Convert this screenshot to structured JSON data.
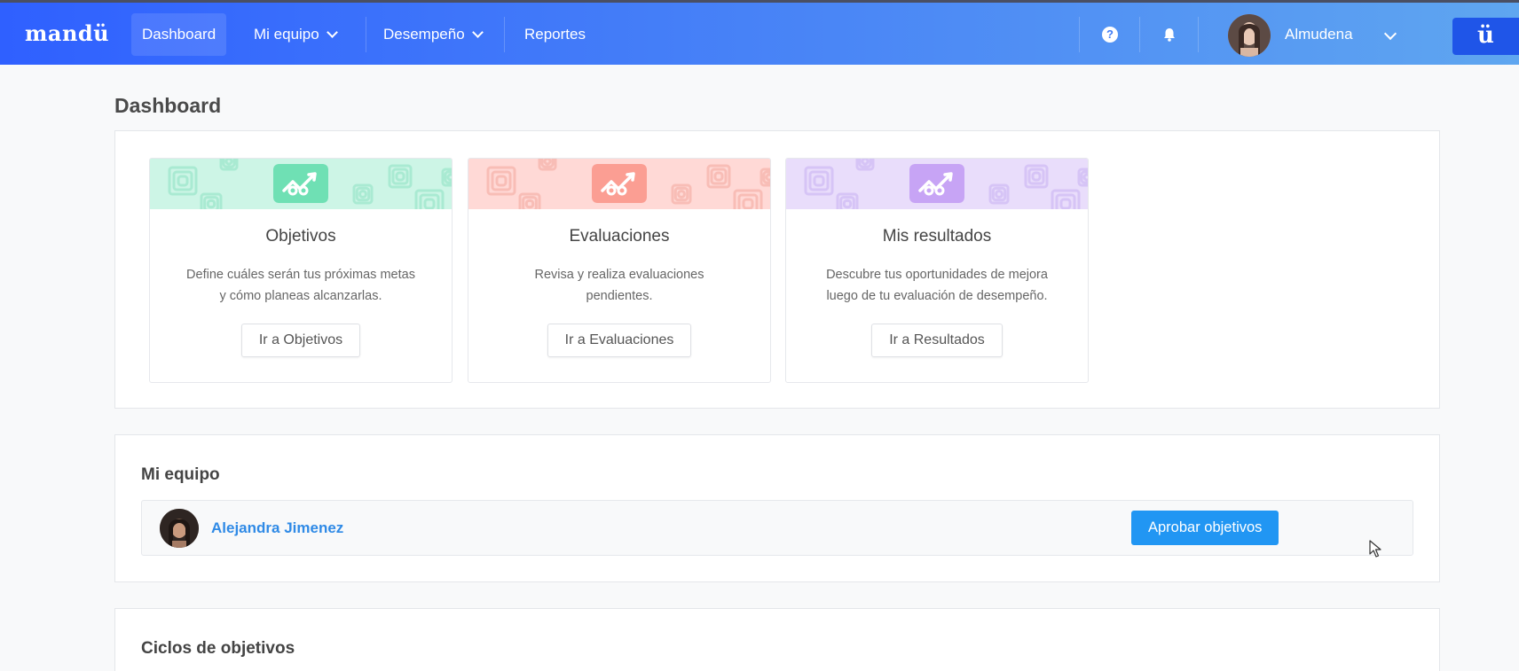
{
  "app": {
    "logo_text": "mandü",
    "brand_button_text": "ü"
  },
  "nav": {
    "items": [
      {
        "label": "Dashboard",
        "active": true,
        "has_dropdown": false
      },
      {
        "label": "Mi equipo",
        "active": false,
        "has_dropdown": true
      },
      {
        "label": "Desempeño",
        "active": false,
        "has_dropdown": true
      },
      {
        "label": "Reportes",
        "active": false,
        "has_dropdown": false
      }
    ],
    "help_icon": "question-circle-icon",
    "help_glyph": "?",
    "notifications_icon": "bell-icon",
    "user": {
      "name": "Almudena"
    }
  },
  "page": {
    "title": "Dashboard"
  },
  "cards": [
    {
      "title": "Objetivos",
      "desc_line1": "Define cuáles serán tus próximas metas",
      "desc_line2": "y cómo planeas alcanzarlas.",
      "button": "Ir a Objetivos",
      "banner_color": "#cdf5e6",
      "icon_color": "#6fe0b4",
      "pattern_color": "#a9ead2"
    },
    {
      "title": "Evaluaciones",
      "desc_line1": "Revisa y realiza evaluaciones",
      "desc_line2": "pendientes.",
      "button": "Ir a Evaluaciones",
      "banner_color": "#ffd9d6",
      "icon_color": "#fb9e93",
      "pattern_color": "#f8bdb6"
    },
    {
      "title": "Mis resultados",
      "desc_line1": "Descubre tus oportunidades de mejora",
      "desc_line2": "luego de tu evaluación de desempeño.",
      "button": "Ir a Resultados",
      "banner_color": "#e9ddfb",
      "icon_color": "#c7a4f5",
      "pattern_color": "#d6c4f6"
    }
  ],
  "team": {
    "title": "Mi equipo",
    "members": [
      {
        "name": "Alejandra Jimenez",
        "action": "Aprobar objetivos"
      }
    ]
  },
  "cycles": {
    "title": "Ciclos de objetivos"
  },
  "colors": {
    "nav_gradient_start": "#2f60ff",
    "nav_gradient_end": "#5fa6f0",
    "primary_button": "#2196f3",
    "link": "#2f8ae6"
  }
}
